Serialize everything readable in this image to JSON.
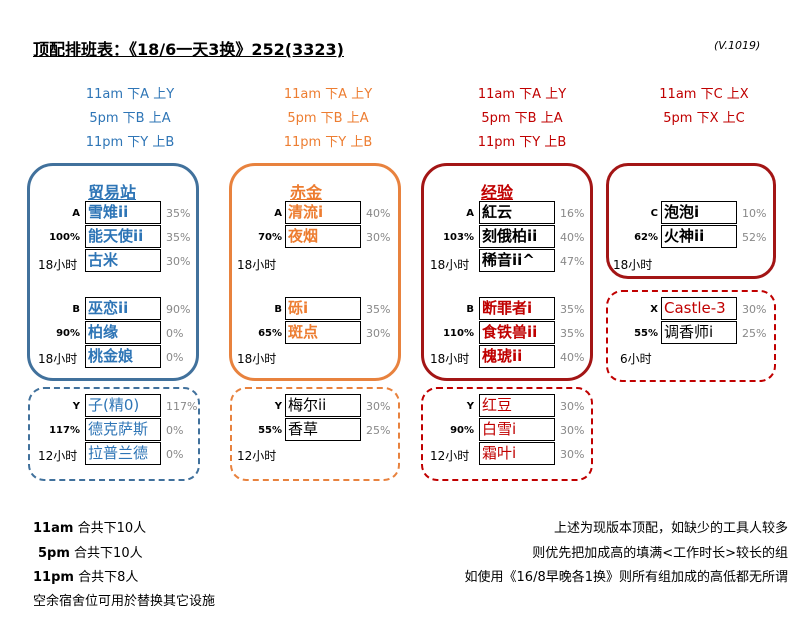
{
  "title": "顶配排班表：《18/6一天3换》252(3323)",
  "version": "(V.1019)",
  "colors": {
    "blue": "#2e75b6",
    "blue_border": "#41719c",
    "orange": "#ed7d31",
    "orange_border": "#e8823e",
    "red": "#c00000",
    "red_border": "#a31515",
    "gray": "#888888"
  },
  "schedules": [
    {
      "lines": [
        "11am 下A 上Y",
        "5pm 下B 上A",
        "11pm 下Y 上B"
      ],
      "color": "blue"
    },
    {
      "lines": [
        "11am 下A 上Y",
        "5pm 下B 上A",
        "11pm 下Y 上B"
      ],
      "color": "orange"
    },
    {
      "lines": [
        "11am 下A 上Y",
        "5pm 下B 上A",
        "11pm 下Y 上B"
      ],
      "color": "red"
    },
    {
      "lines": [
        "11am 下C 上X",
        "5pm 下X 上C"
      ],
      "color": "red"
    }
  ],
  "groups": {
    "trade": {
      "name": "贸易站"
    },
    "red_gold": {
      "name": "赤金"
    },
    "exp": {
      "name": "经验"
    }
  },
  "teams": {
    "t_a": {
      "slot": "A",
      "bonus": "100%",
      "hours": "18小时",
      "members": [
        {
          "name": "雪雉ii",
          "pct": "35%"
        },
        {
          "name": "能天使ii",
          "pct": "35%"
        },
        {
          "name": "古米",
          "pct": "30%"
        }
      ]
    },
    "t_b": {
      "slot": "B",
      "bonus": "90%",
      "hours": "18小时",
      "members": [
        {
          "name": "巫恋ii",
          "pct": "90%"
        },
        {
          "name": "柏缘",
          "pct": "0%"
        },
        {
          "name": "桃金娘",
          "pct": "0%"
        }
      ]
    },
    "t_y": {
      "slot": "Y",
      "bonus": "117%",
      "hours": "12小时",
      "members": [
        {
          "name": "子(精0)",
          "pct": "117%"
        },
        {
          "name": "德克萨斯",
          "pct": "0%"
        },
        {
          "name": "拉普兰德",
          "pct": "0%"
        }
      ]
    },
    "g_a": {
      "slot": "A",
      "bonus": "70%",
      "hours": "18小时",
      "members": [
        {
          "name": "清流i",
          "pct": "40%"
        },
        {
          "name": "夜烟",
          "pct": "30%"
        }
      ]
    },
    "g_b": {
      "slot": "B",
      "bonus": "65%",
      "hours": "18小时",
      "members": [
        {
          "name": "砾i",
          "pct": "35%"
        },
        {
          "name": "斑点",
          "pct": "30%"
        }
      ]
    },
    "g_y": {
      "slot": "Y",
      "bonus": "55%",
      "hours": "12小时",
      "members": [
        {
          "name": "梅尔ii",
          "pct": "30%"
        },
        {
          "name": "香草",
          "pct": "25%"
        }
      ]
    },
    "e_a": {
      "slot": "A",
      "bonus": "103%",
      "hours": "18小时",
      "members": [
        {
          "name": "紅云",
          "pct": "16%"
        },
        {
          "name": "刻俄柏ii",
          "pct": "40%"
        },
        {
          "name": "稀音ii^",
          "pct": "47%"
        }
      ]
    },
    "e_b": {
      "slot": "B",
      "bonus": "110%",
      "hours": "18小时",
      "members": [
        {
          "name": "断罪者i",
          "pct": "35%"
        },
        {
          "name": "食铁兽ii",
          "pct": "35%"
        },
        {
          "name": "槐琥ii",
          "pct": "40%"
        }
      ]
    },
    "e_y": {
      "slot": "Y",
      "bonus": "90%",
      "hours": "12小时",
      "members": [
        {
          "name": "红豆",
          "pct": "30%"
        },
        {
          "name": "白雪i",
          "pct": "30%"
        },
        {
          "name": "霜叶i",
          "pct": "30%"
        }
      ]
    },
    "x_c": {
      "slot": "C",
      "bonus": "62%",
      "hours": "18小时",
      "members": [
        {
          "name": "泡泡i",
          "pct": "10%"
        },
        {
          "name": "火神ii",
          "pct": "52%"
        }
      ]
    },
    "x_x": {
      "slot": "X",
      "bonus": "55%",
      "hours": "6小时",
      "members": [
        {
          "name": "Castle-3",
          "pct": "30%"
        },
        {
          "name": "调香师i",
          "pct": "25%"
        }
      ]
    }
  },
  "footer_left": [
    {
      "time": "11am",
      "text": "合共下10人"
    },
    {
      "time": "5pm",
      "text": "合共下10人"
    },
    {
      "time": "11pm",
      "text": "合共下8人"
    },
    {
      "time": "",
      "text": "空余宿舍位可用於替换其它设施"
    }
  ],
  "footer_right": [
    "上述为现版本顶配，如缺少的工具人较多",
    "则优先把加成高的填满<工作时长>较长的组",
    "如使用《16/8早晚各1换》则所有组加成的高低都无所谓"
  ]
}
